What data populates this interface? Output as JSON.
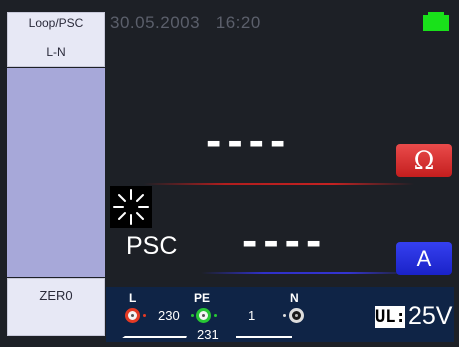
{
  "menu": {
    "mode_title": "Loop/PSC",
    "mode_sub": "L-N",
    "zero_button": "ZER0"
  },
  "status": {
    "date": "30.05.2003",
    "time": "16:20",
    "battery_color": "#19e11a"
  },
  "display": {
    "top_reading": "----",
    "bottom_reading": "----",
    "top_unit": "Ω",
    "bottom_unit": "A",
    "psc_label": "PSC",
    "activity_icon": "spinner-icon"
  },
  "terminals": {
    "L": {
      "label": "L",
      "value": "230"
    },
    "PE": {
      "label": "PE",
      "value_right": "1",
      "value_below": "231"
    },
    "N": {
      "label": "N"
    }
  },
  "voltage": {
    "label": "UL:",
    "value": "25V"
  },
  "colors": {
    "ohm_unit": "#d42a2a",
    "amp_unit": "#2430e0",
    "terminal_bar": "#0f2446",
    "menu_mid": "#a7a8d9"
  }
}
